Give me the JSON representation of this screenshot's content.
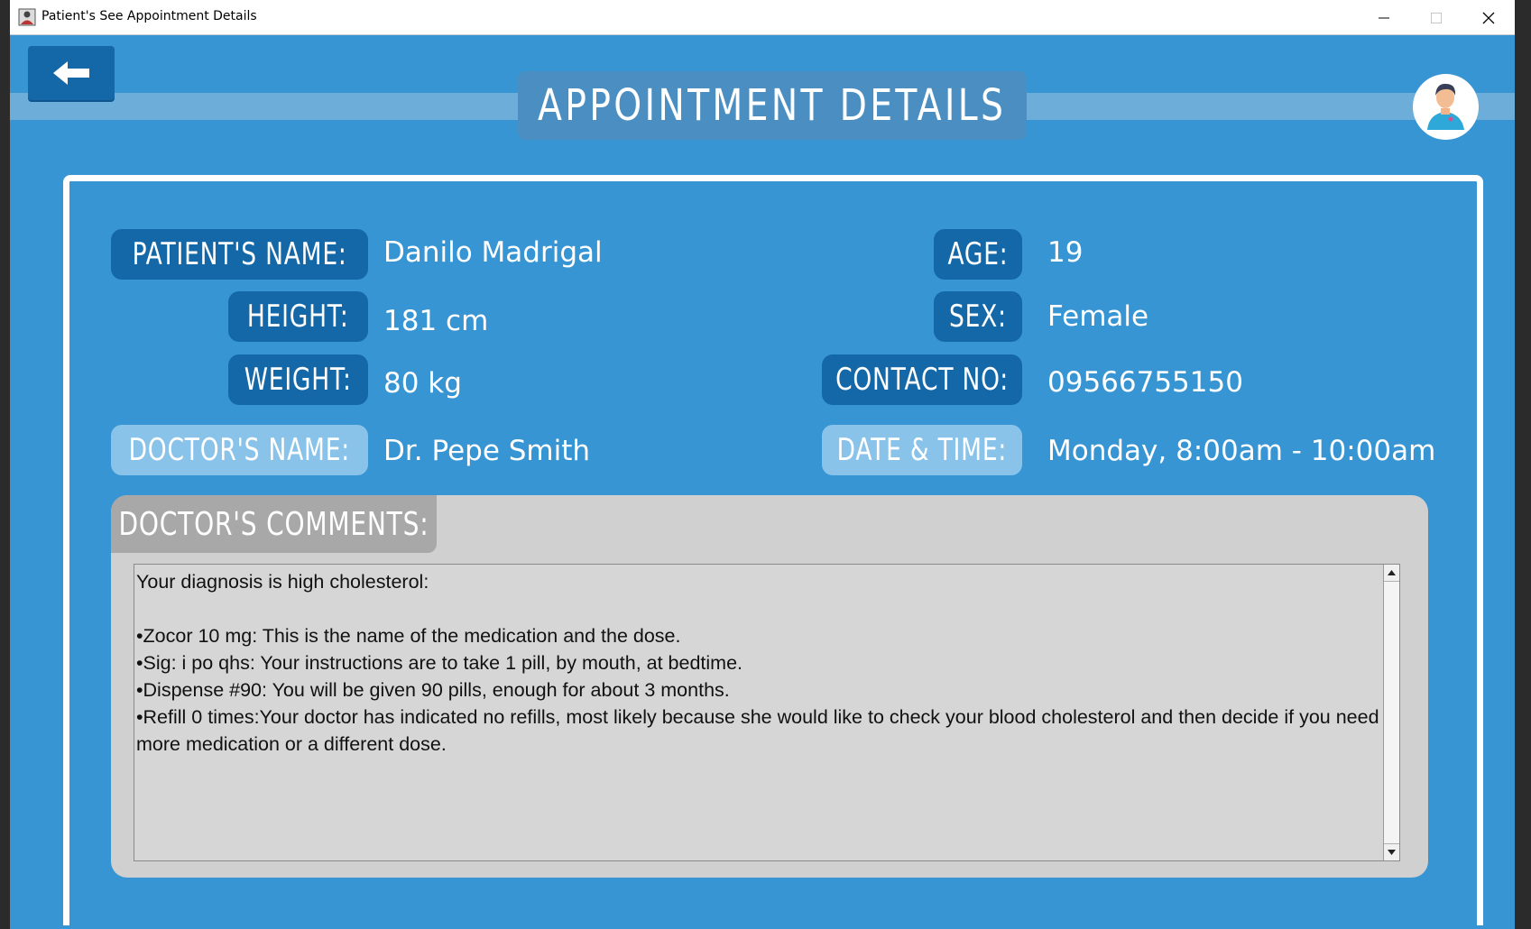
{
  "window": {
    "title": "Patient's See Appointment Details",
    "controls": [
      "minimize",
      "maximize",
      "close"
    ]
  },
  "header": {
    "title": "APPOINTMENT DETAILS",
    "back_icon": "arrow-left-icon",
    "avatar_icon": "user-avatar-icon"
  },
  "details": {
    "patient_name_label": "PATIENT'S NAME:",
    "patient_name": "Danilo Madrigal",
    "height_label": "HEIGHT:",
    "height": "181 cm",
    "weight_label": "WEIGHT:",
    "weight": "80 kg",
    "doctor_name_label": "DOCTOR'S NAME:",
    "doctor_name": "Dr. Pepe Smith",
    "age_label": "AGE:",
    "age": "19",
    "sex_label": "SEX:",
    "sex": "Female",
    "contact_label": "CONTACT NO:",
    "contact": "09566755150",
    "datetime_label": "DATE & TIME:",
    "datetime": "Monday, 8:00am - 10:00am"
  },
  "comments": {
    "label": "DOCTOR'S COMMENTS:",
    "text": "Your diagnosis is high cholesterol:\n\n•Zocor 10 mg: This is the name of the medication and the dose.\n•Sig: i po qhs: Your instructions are to take 1 pill, by mouth, at bedtime.\n•Dispense #90: You will be given 90 pills, enough for about 3 months.\n•Refill 0 times:Your doctor has indicated no refills, most likely because she would like to check your blood cholesterol and then decide if you need more medication or a different dose."
  },
  "colors": {
    "background": "#3895d3",
    "label_dark": "#1568a8",
    "label_light": "#8ac3ea",
    "comments_panel": "#d0d0d0"
  }
}
